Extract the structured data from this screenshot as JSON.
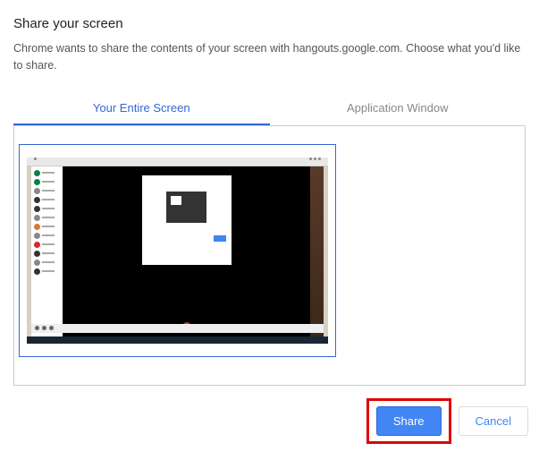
{
  "dialog": {
    "title": "Share your screen",
    "description": "Chrome wants to share the contents of your screen with hangouts.google.com. Choose what you'd like to share."
  },
  "tabs": {
    "entire_screen": "Your Entire Screen",
    "app_window": "Application Window"
  },
  "buttons": {
    "share": "Share",
    "cancel": "Cancel"
  }
}
